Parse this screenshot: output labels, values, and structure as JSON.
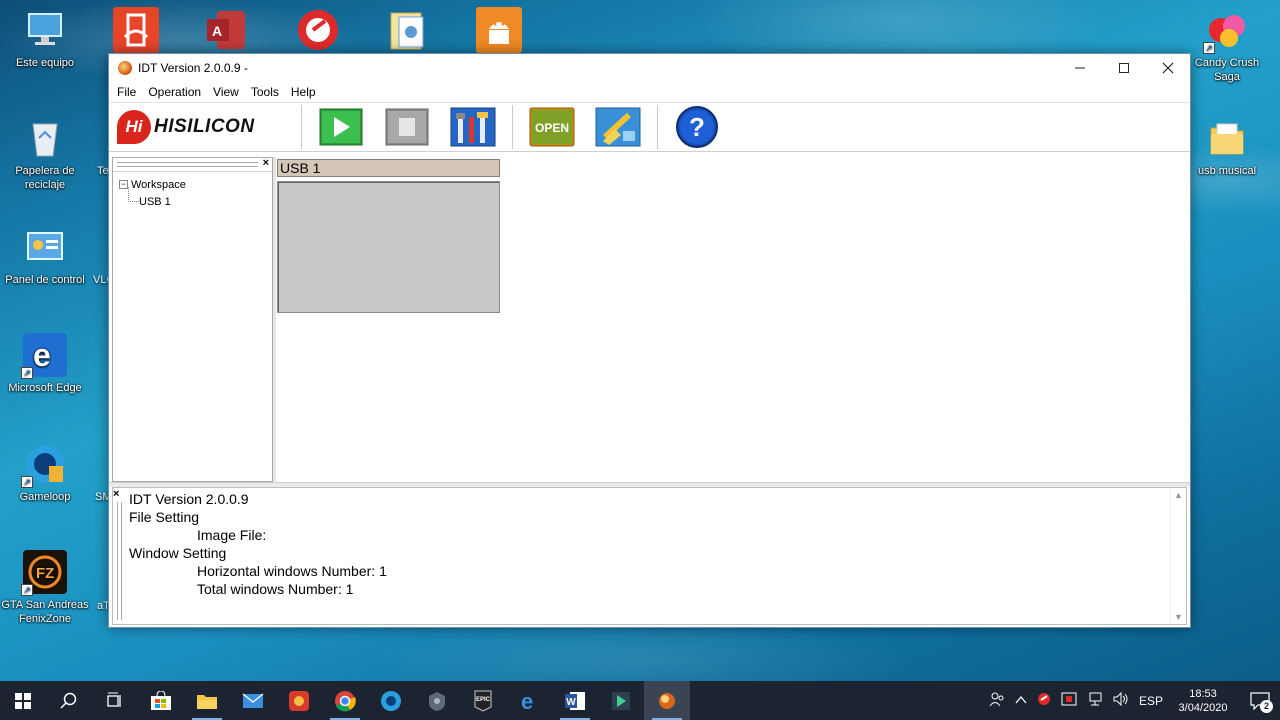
{
  "desktop": {
    "icons_left": [
      {
        "label": "Este equipo",
        "icon": "computer-icon"
      },
      {
        "label": "Papelera de reciclaje",
        "icon": "recycle-bin-icon"
      },
      {
        "label": "Panel de control",
        "icon": "control-panel-icon"
      },
      {
        "label": "Microsoft Edge",
        "icon": "edge-icon"
      },
      {
        "label": "Gameloop",
        "icon": "gameloop-icon"
      },
      {
        "label": "GTA San Andreas FenixZone",
        "icon": "fenixzone-icon"
      }
    ],
    "partial_labels": [
      "Te",
      "VLC",
      "SM",
      "aT"
    ],
    "icons_right": [
      {
        "label": "Candy Crush Saga",
        "icon": "candy-crush-icon"
      },
      {
        "label": "usb musical",
        "icon": "folder-icon"
      }
    ],
    "icons_top": [
      "pdf-app-icon",
      "access-icon",
      "app-red-icon",
      "document-folder-icon",
      "android-icon"
    ]
  },
  "window": {
    "title": "IDT Version 2.0.0.9 -",
    "menu": [
      "File",
      "Operation",
      "View",
      "Tools",
      "Help"
    ],
    "logo_text": "HISILICON",
    "logo_mark": "Hi",
    "toolbar_buttons": [
      "play-icon",
      "stop-icon",
      "tools-icon",
      "open-icon",
      "brush-icon",
      "help-icon"
    ],
    "open_label": "OPEN",
    "help_glyph": "?",
    "tree": {
      "root": "Workspace",
      "child": "USB 1"
    },
    "usb_panel_title": "USB 1",
    "log": {
      "lines": [
        {
          "text": "IDT Version 2.0.0.9",
          "indent": false
        },
        {
          "text": "File Setting",
          "indent": false
        },
        {
          "text": "Image File:",
          "indent": true
        },
        {
          "text": "Window Setting",
          "indent": false
        },
        {
          "text": "Horizontal windows Number: 1",
          "indent": true
        },
        {
          "text": "Total windows Number: 1",
          "indent": true
        }
      ]
    }
  },
  "taskbar": {
    "items": [
      "windows-start-icon",
      "search-icon",
      "task-view-icon",
      "store-icon",
      "file-explorer-icon",
      "mail-icon",
      "app-icon",
      "chrome-icon",
      "gameloop-taskbar-icon",
      "wot-icon",
      "epic-games-icon",
      "edge-taskbar-icon",
      "word-icon",
      "app-green-icon",
      "idt-taskbar-icon"
    ],
    "language": "ESP",
    "time": "18:53",
    "date": "3/04/2020",
    "notification_count": "2"
  }
}
